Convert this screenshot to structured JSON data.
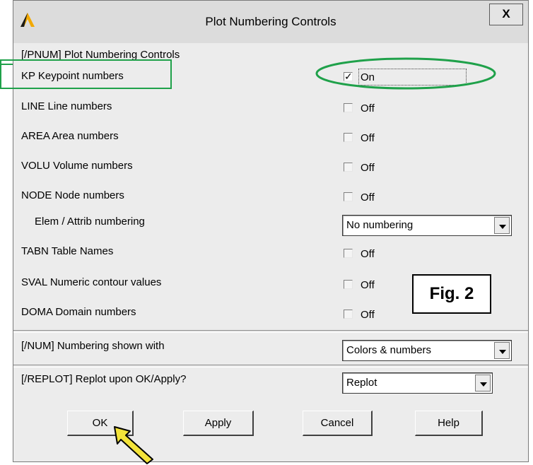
{
  "window": {
    "title": "Plot Numbering Controls",
    "close_label": "X",
    "app_icon": "ansys-logo-icon"
  },
  "section_header": "[/PNUM] Plot Numbering Controls",
  "rows": [
    {
      "label": "KP   Keypoint numbers",
      "state": "On",
      "checked": true
    },
    {
      "label": "LINE  Line numbers",
      "state": "Off",
      "checked": false
    },
    {
      "label": "AREA  Area numbers",
      "state": "Off",
      "checked": false
    },
    {
      "label": "VOLU  Volume numbers",
      "state": "Off",
      "checked": false
    },
    {
      "label": "NODE  Node numbers",
      "state": "Off",
      "checked": false
    },
    {
      "label": "TABN  Table Names",
      "state": "Off",
      "checked": false
    },
    {
      "label": "SVAL  Numeric contour values",
      "state": "Off",
      "checked": false
    },
    {
      "label": "DOMA  Domain numbers",
      "state": "Off",
      "checked": false
    }
  ],
  "elem_attrib": {
    "label": "Elem / Attrib numbering",
    "value": "No numbering"
  },
  "num": {
    "label": "[/NUM]  Numbering shown with",
    "value": "Colors & numbers"
  },
  "replot": {
    "label": "[/REPLOT] Replot upon OK/Apply?",
    "value": "Replot"
  },
  "buttons": {
    "ok": "OK",
    "apply": "Apply",
    "cancel": "Cancel",
    "help": "Help"
  },
  "annotation": {
    "figure_label": "Fig. 2",
    "highlight_color": "#1fa14a"
  }
}
